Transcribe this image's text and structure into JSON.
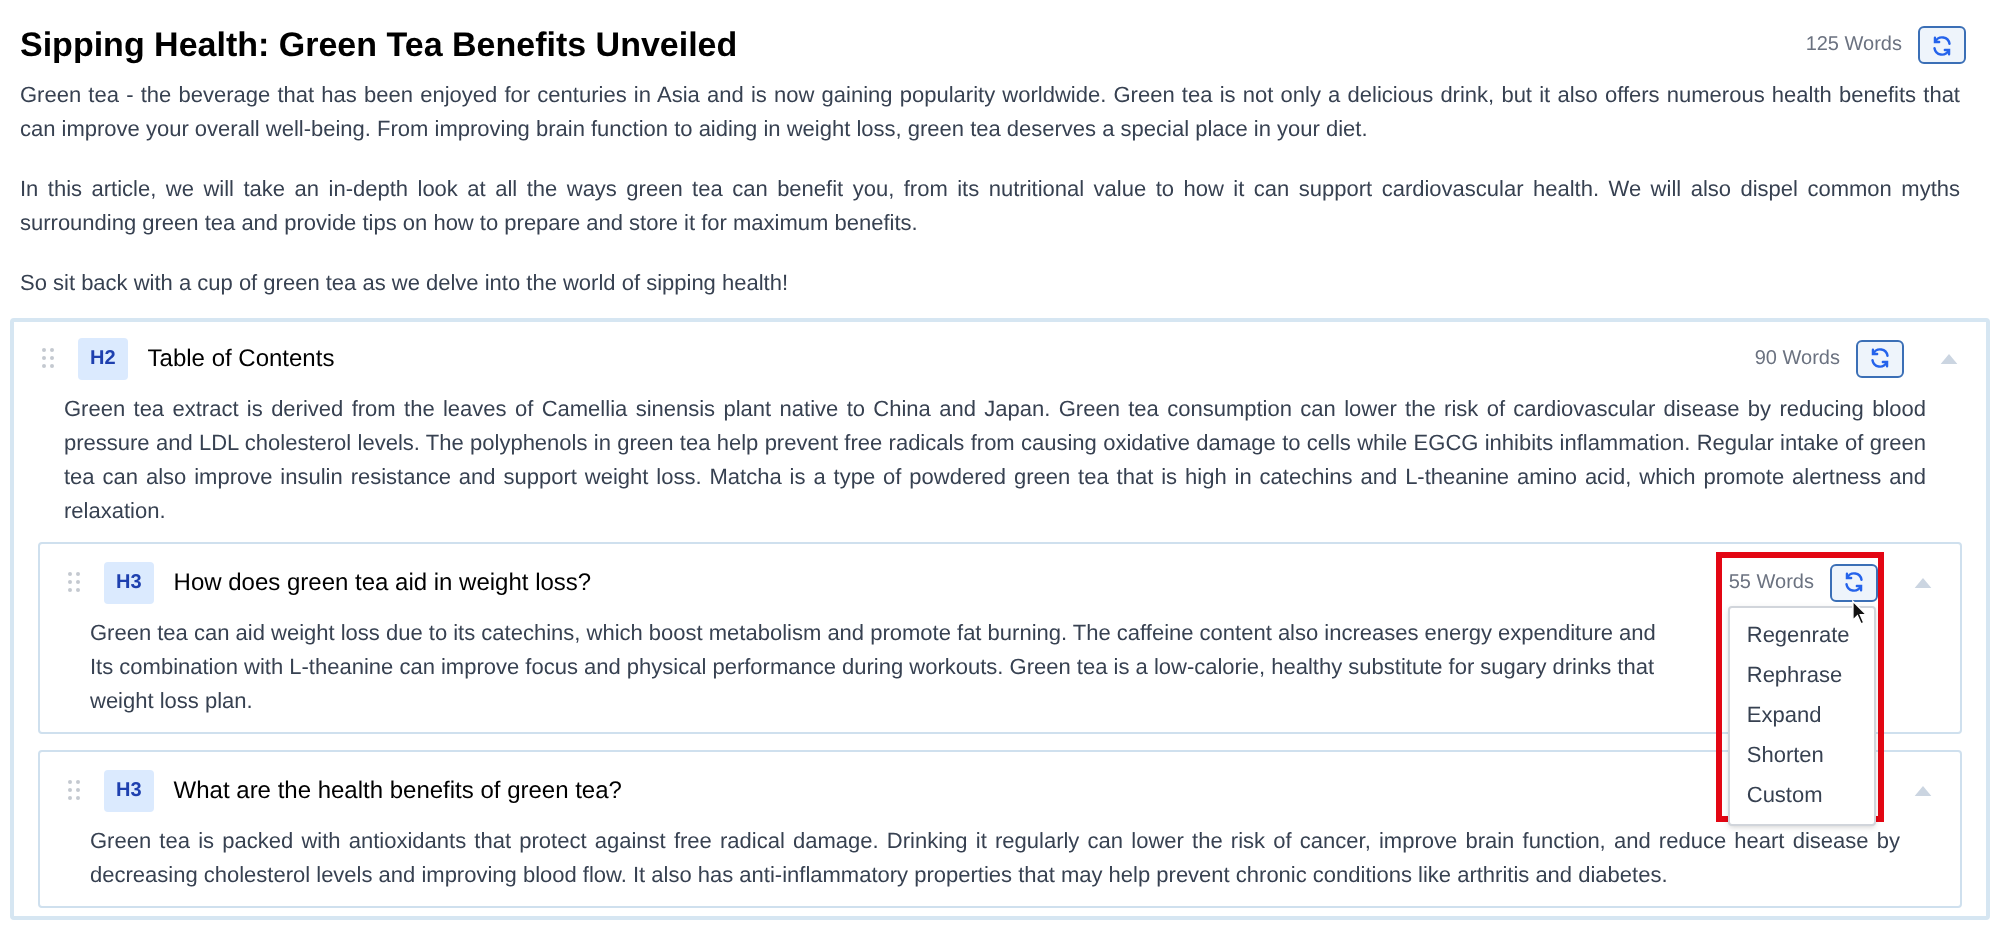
{
  "article": {
    "title": "Sipping Health: Green Tea Benefits Unveiled",
    "word_count": "125 Words"
  },
  "intro": [
    "Green tea - the beverage that has been enjoyed for centuries in Asia and is now gaining popularity worldwide. Green tea is not only a delicious drink, but it also offers numerous health benefits that can improve your overall well-being. From improving brain function to aiding in weight loss, green tea deserves a special place in your diet.",
    "In this article, we will take an in-depth look at all the ways green tea can benefit you, from its nutritional value to how it can support cardiovascular health. We will also dispel common myths surrounding green tea and provide tips on how to prepare and store it for maximum benefits.",
    "So sit back with a cup of green tea as we delve into the world of sipping health!"
  ],
  "sections": [
    {
      "level": "H2",
      "title": "Table of Contents",
      "word_count": "90 Words",
      "expanded": true,
      "body": "Green tea extract is derived from the leaves of Camellia sinensis plant native to China and Japan. Green tea consumption can lower the risk of cardiovascular disease by reducing blood pressure and LDL cholesterol levels. The polyphenols in green tea help prevent free radicals from causing oxidative damage to cells while EGCG inhibits inflammation. Regular intake of green tea can also improve insulin resistance and support weight loss. Matcha is a type of powdered green tea that is high in catechins and L-theanine amino acid, which promote alertness and relaxation.",
      "children": [
        {
          "level": "H3",
          "title": "How does green tea aid in weight loss?",
          "word_count": "55 Words",
          "expanded": true,
          "highlighted": true,
          "body_lines": [
            "Green tea can aid weight loss due to its catechins, which boost metabolism and promote fat burning. The caffeine content also increases energy expenditure and",
            "Its combination with L-theanine can improve focus and physical performance during workouts. Green tea is a low-calorie, healthy substitute for sugary drinks that",
            "weight loss plan."
          ],
          "menu": [
            "Regenrate",
            "Rephrase",
            "Expand",
            "Shorten",
            "Custom"
          ]
        },
        {
          "level": "H3",
          "title": "What are the health benefits of green tea?",
          "expanded": true,
          "body": "Green tea is packed with antioxidants that protect against free radical damage. Drinking it regularly can lower the risk of cancer, improve brain function, and reduce heart disease by decreasing cholesterol levels and improving blood flow. It also has anti-inflammatory properties that may help prevent chronic conditions like arthritis and diabetes."
        }
      ]
    }
  ]
}
